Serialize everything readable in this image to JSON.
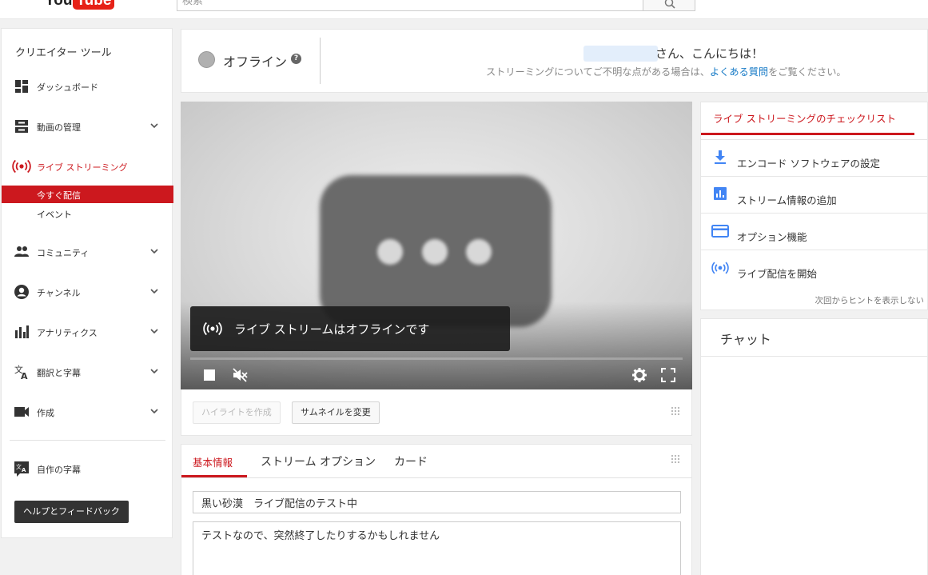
{
  "topbar": {
    "logo_text": "You",
    "logo_tube": "Tube",
    "search_placeholder": "検索"
  },
  "sidebar": {
    "title": "クリエイター ツール",
    "items": [
      {
        "label": "ダッシュボード",
        "icon": "dashboard-icon"
      },
      {
        "label": "動画の管理",
        "icon": "video-manager-icon"
      },
      {
        "label": "ライブ ストリーミング",
        "icon": "live-icon"
      },
      {
        "label": "コミュニティ",
        "icon": "community-icon"
      },
      {
        "label": "チャンネル",
        "icon": "channel-icon"
      },
      {
        "label": "アナリティクス",
        "icon": "analytics-icon"
      },
      {
        "label": "翻訳と字幕",
        "icon": "translate-icon"
      },
      {
        "label": "作成",
        "icon": "create-icon"
      },
      {
        "label": "自作の字幕",
        "icon": "subtitles-icon"
      }
    ],
    "sub_items": [
      {
        "label": "今すぐ配信",
        "active": true
      },
      {
        "label": "イベント",
        "active": false
      }
    ],
    "help_button": "ヘルプとフィードバック"
  },
  "status": {
    "state": "オフライン",
    "help_icon_glyph": "?",
    "greeting": "さん、こんにちは！",
    "help_text_before": "ストリーミングについてご不明な点がある場合は、",
    "help_link": "よくある質問",
    "help_text_after": "をご覧ください。"
  },
  "player": {
    "offline_message": "ライブ ストリームはオフラインです"
  },
  "actions": {
    "highlight_button": "ハイライトを作成",
    "thumbnail_button": "サムネイルを変更"
  },
  "tabs": {
    "items": [
      "基本情報",
      "ストリーム オプション",
      "カード"
    ],
    "active": 0
  },
  "basic_info": {
    "title_value": "黒い砂漠　ライブ配信のテスト中",
    "description_value": "テストなので、突然終了したりするかもしれません"
  },
  "checklist": {
    "title": "ライブ ストリーミングのチェックリスト",
    "items": [
      {
        "label": "エンコード ソフトウェアの設定",
        "icon": "download-icon"
      },
      {
        "label": "ストリーム情報の追加",
        "icon": "chart-icon"
      },
      {
        "label": "オプション機能",
        "icon": "card-icon"
      },
      {
        "label": "ライブ配信を開始",
        "icon": "broadcast-icon"
      }
    ],
    "footer": "次回からヒントを表示しない"
  },
  "chat": {
    "title": "チャット"
  },
  "colors": {
    "accent_red": "#cc181e",
    "link_blue": "#167ac6",
    "icon_blue": "#4285f4"
  }
}
